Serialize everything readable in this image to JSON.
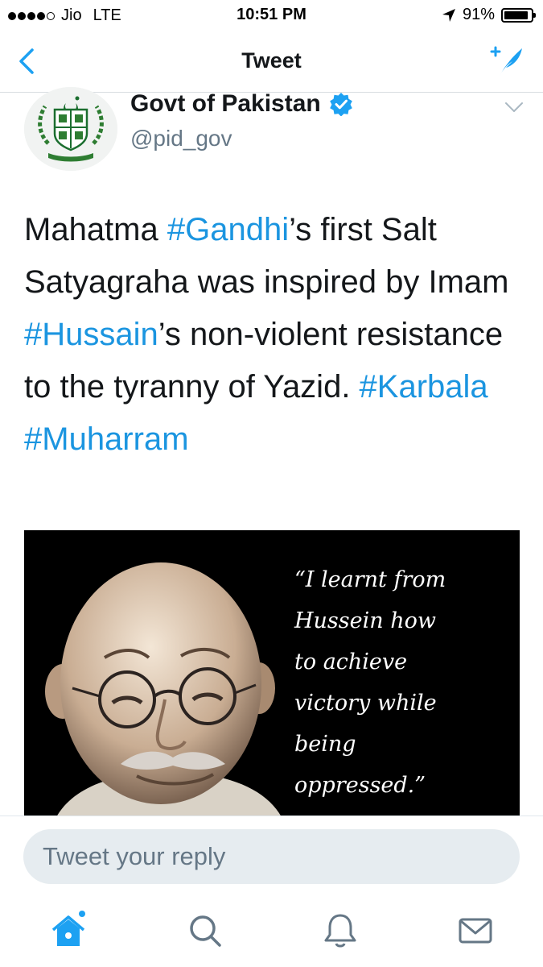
{
  "status_bar": {
    "carrier": "Jio",
    "network": "LTE",
    "time": "10:51 PM",
    "battery_percent": "91%",
    "battery_level": 0.91,
    "signal_bars": 4
  },
  "nav": {
    "title": "Tweet",
    "back_icon": "chevron-left-icon",
    "compose_icon": "compose-tweet-icon"
  },
  "tweet": {
    "author_name": "Govt of Pakistan",
    "handle": "@pid_gov",
    "verified": true,
    "text_parts": {
      "p1": "Mahatma ",
      "tag_gandhi": "#Gandhi",
      "p2": "’s first Salt Satyagraha was inspired by Imam ",
      "tag_hussain": "#Hussain",
      "p3": "’s non-violent resistance to the tyranny of Yazid. ",
      "tag_karbala": "#Karbala",
      "space": " ",
      "tag_muharram": "#Muharram"
    },
    "image_quote": "“I learnt from\nHussein how\nto achieve\nvictory while\nbeing\noppressed.”"
  },
  "reply": {
    "placeholder": "Tweet your reply"
  },
  "tabs": [
    {
      "icon": "home-icon",
      "active": true
    },
    {
      "icon": "search-icon",
      "active": false
    },
    {
      "icon": "notifications-bell-icon",
      "active": false
    },
    {
      "icon": "messages-envelope-icon",
      "active": false
    }
  ],
  "colors": {
    "accent": "#1b95e0",
    "handle": "#657786",
    "reply_bg": "#e6ecf0"
  }
}
